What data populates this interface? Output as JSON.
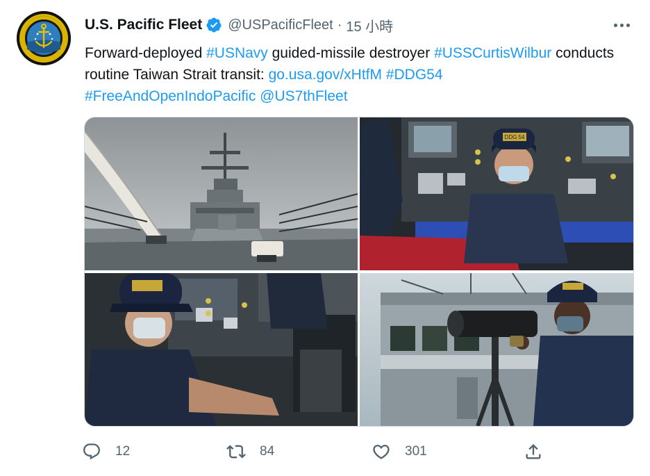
{
  "user": {
    "display_name": "U.S. Pacific Fleet",
    "handle": "@USPacificFleet",
    "separator": "·",
    "time": "15 小時",
    "avatar_text_top": "COMMANDER",
    "avatar_text_bottom": "UNITED STATES PACIFIC FLEET"
  },
  "tweet": {
    "segments": [
      {
        "text": "Forward-deployed ",
        "link": false
      },
      {
        "text": "#USNavy",
        "link": true
      },
      {
        "text": " guided-missile destroyer ",
        "link": false
      },
      {
        "text": "#USSCurtisWilbur",
        "link": true
      },
      {
        "text": " conducts routine Taiwan Strait transit: ",
        "link": false
      },
      {
        "text": "go.usa.gov/xHtfM",
        "link": true
      },
      {
        "text": " ",
        "link": false
      },
      {
        "text": "#DDG54",
        "link": true
      },
      {
        "text": " ",
        "link": false
      },
      {
        "text": "#FreeAndOpenIndoPacific",
        "link": true
      },
      {
        "text": " ",
        "link": false
      },
      {
        "text": "@US7thFleet",
        "link": true
      }
    ]
  },
  "media": {
    "photos": [
      {
        "subject": "destroyer bow and mast from deck"
      },
      {
        "subject": "sailor with mask at bridge console"
      },
      {
        "subject": "sailor with mask at controls"
      },
      {
        "subject": "sailor looking through big-eye binoculars"
      }
    ],
    "cap_text": "DDG 54"
  },
  "actions": {
    "reply_count": "12",
    "retweet_count": "84",
    "like_count": "301",
    "icons": [
      "reply-icon",
      "retweet-icon",
      "like-icon",
      "share-icon"
    ]
  },
  "colors": {
    "text": "#0f1419",
    "secondary": "#536471",
    "link": "#1d9bf0",
    "verified": "#1d9bf0",
    "border": "#cfd9de"
  }
}
